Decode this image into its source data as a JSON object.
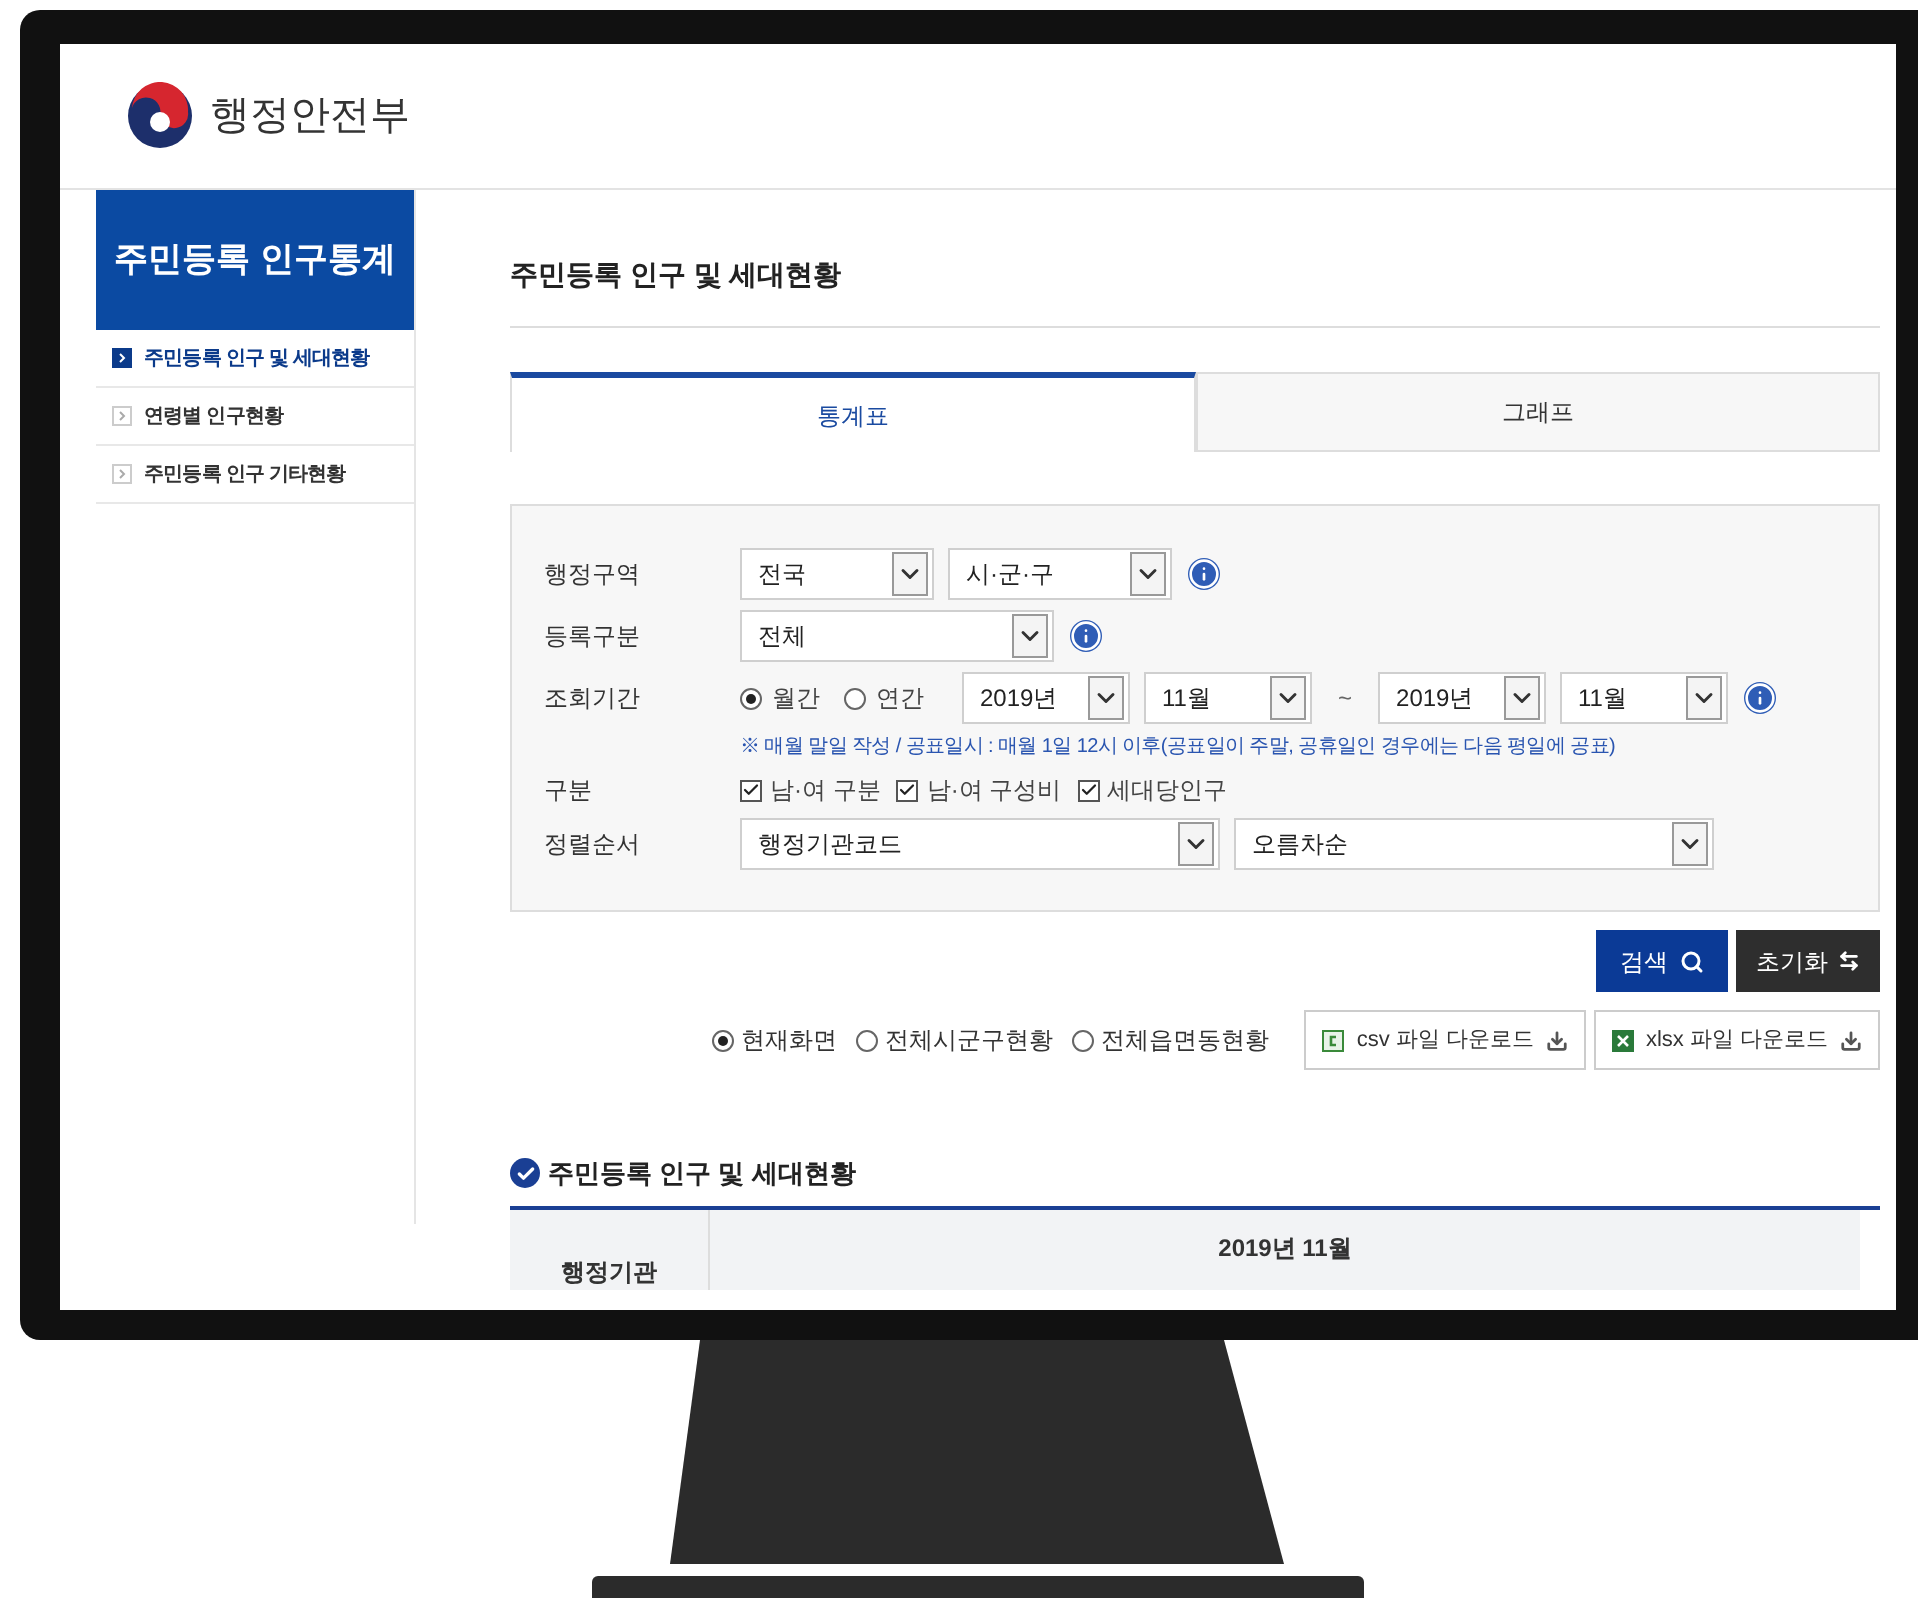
{
  "header": {
    "logo_text": "행정안전부"
  },
  "sidebar": {
    "title": "주민등록 인구통계",
    "items": [
      {
        "label": "주민등록 인구 및 세대현황",
        "selected": true
      },
      {
        "label": "연령별 인구현황",
        "selected": false
      },
      {
        "label": "주민등록 인구 기타현황",
        "selected": false
      }
    ]
  },
  "page_title": "주민등록 인구 및 세대현황",
  "tabs": [
    {
      "label": "통계표",
      "selected": true
    },
    {
      "label": "그래프",
      "selected": false
    }
  ],
  "filters": [
    {
      "kind": "selects",
      "label": "행정구역",
      "info": true,
      "selects": [
        {
          "value": "전국"
        },
        {
          "value": "시·군·구"
        }
      ]
    },
    {
      "kind": "selects",
      "label": "등록구분",
      "info": true,
      "selects": [
        {
          "value": "전체"
        }
      ]
    },
    {
      "kind": "period",
      "label": "조회기간",
      "info": true,
      "radios": [
        {
          "label": "월간",
          "selected": true
        },
        {
          "label": "연간",
          "selected": false
        }
      ],
      "from": [
        "2019년",
        "11월"
      ],
      "separator": "~",
      "to": [
        "2019년",
        "11월"
      ],
      "note": "※ 매월 말일 작성 / 공표일시 : 매월 1일 12시 이후(공표일이 주말, 공휴일인 경우에는 다음 평일에 공표)"
    },
    {
      "kind": "checks",
      "label": "구분",
      "checks": [
        {
          "label": "남·여 구분",
          "checked": true
        },
        {
          "label": "남·여 구성비",
          "checked": true
        },
        {
          "label": "세대당인구",
          "checked": true
        }
      ]
    },
    {
      "kind": "selects",
      "label": "정렬순서",
      "info": false,
      "selects": [
        {
          "value": "행정기관코드"
        },
        {
          "value": "오름차순"
        }
      ]
    }
  ],
  "search_button": "검색",
  "reset_button": "초기화",
  "scope_options": [
    {
      "label": "현재화면",
      "selected": true
    },
    {
      "label": "전체시군구현황",
      "selected": false
    },
    {
      "label": "전체읍면동현황",
      "selected": false
    }
  ],
  "downloads": [
    {
      "kind": "csv",
      "label": "csv 파일 다운로드"
    },
    {
      "kind": "xlsx",
      "label": "xlsx 파일 다운로드"
    }
  ],
  "section_title": "주민등록 인구 및 세대현황",
  "table": {
    "columns": [
      "행정기관",
      "2019년 11월"
    ]
  }
}
